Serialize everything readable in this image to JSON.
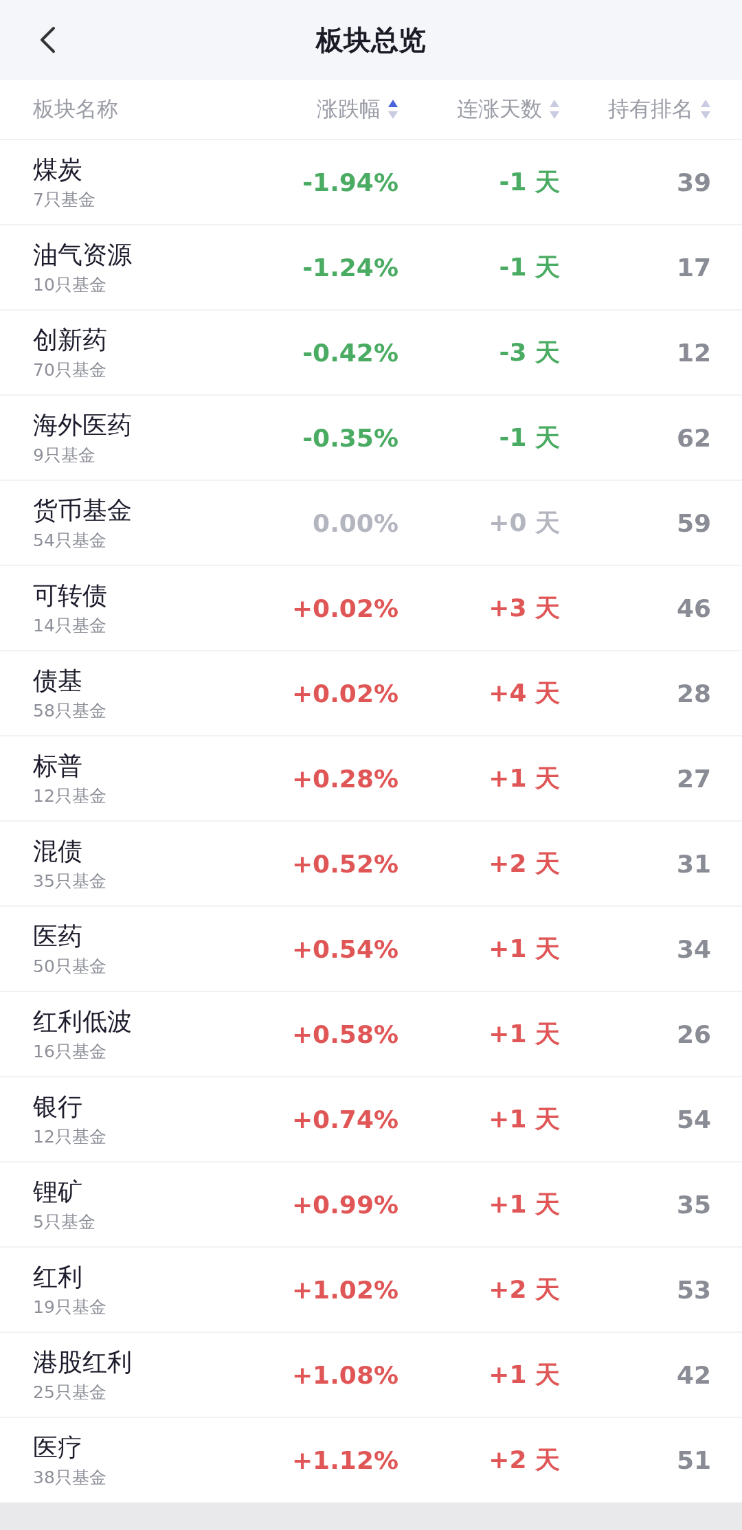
{
  "header": {
    "title": "板块总览"
  },
  "columns": [
    {
      "label": "板块名称"
    },
    {
      "label": "涨跌幅",
      "selected": true
    },
    {
      "label": "连涨天数",
      "selected": false
    },
    {
      "label": "持有排名",
      "selected": false
    }
  ],
  "rows": [
    {
      "name": "煤炭",
      "funds": "7只基金",
      "color": "#4aab62",
      "change": "-1.94%",
      "days": "-1 天",
      "rank": "39"
    },
    {
      "name": "油气资源",
      "funds": "10只基金",
      "color": "#4aab62",
      "change": "-1.24%",
      "days": "-1 天",
      "rank": "17"
    },
    {
      "name": "创新药",
      "funds": "70只基金",
      "color": "#4aab62",
      "change": "-0.42%",
      "days": "-3 天",
      "rank": "12"
    },
    {
      "name": "海外医药",
      "funds": "9只基金",
      "color": "#4aab62",
      "change": "-0.35%",
      "days": "-1 天",
      "rank": "62"
    },
    {
      "name": "货币基金",
      "funds": "54只基金",
      "color": "#b3b5bf",
      "change": "0.00%",
      "days": "+0 天",
      "rank": "59"
    },
    {
      "name": "可转债",
      "funds": "14只基金",
      "color": "#e05656",
      "change": "+0.02%",
      "days": "+3 天",
      "rank": "46"
    },
    {
      "name": "债基",
      "funds": "58只基金",
      "color": "#e05656",
      "change": "+0.02%",
      "days": "+4 天",
      "rank": "28"
    },
    {
      "name": "标普",
      "funds": "12只基金",
      "color": "#e05656",
      "change": "+0.28%",
      "days": "+1 天",
      "rank": "27"
    },
    {
      "name": "混债",
      "funds": "35只基金",
      "color": "#e05656",
      "change": "+0.52%",
      "days": "+2 天",
      "rank": "31"
    },
    {
      "name": "医药",
      "funds": "50只基金",
      "color": "#e05656",
      "change": "+0.54%",
      "days": "+1 天",
      "rank": "34"
    },
    {
      "name": "红利低波",
      "funds": "16只基金",
      "color": "#e05656",
      "change": "+0.58%",
      "days": "+1 天",
      "rank": "26"
    },
    {
      "name": "银行",
      "funds": "12只基金",
      "color": "#e05656",
      "change": "+0.74%",
      "days": "+1 天",
      "rank": "54"
    },
    {
      "name": "锂矿",
      "funds": "5只基金",
      "color": "#e05656",
      "change": "+0.99%",
      "days": "+1 天",
      "rank": "35"
    },
    {
      "name": "红利",
      "funds": "19只基金",
      "color": "#e05656",
      "change": "+1.02%",
      "days": "+2 天",
      "rank": "53"
    },
    {
      "name": "港股红利",
      "funds": "25只基金",
      "color": "#e05656",
      "change": "+1.08%",
      "days": "+1 天",
      "rank": "42"
    },
    {
      "name": "医疗",
      "funds": "38只基金",
      "color": "#e05656",
      "change": "+1.12%",
      "days": "+2 天",
      "rank": "51"
    }
  ]
}
